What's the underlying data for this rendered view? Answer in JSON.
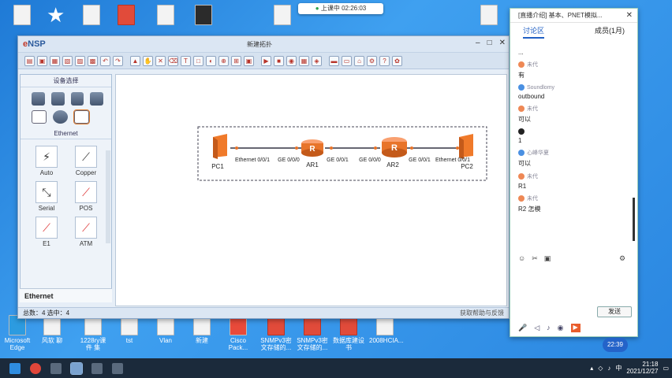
{
  "desktop": {
    "bottom_icons": [
      {
        "label": "Microsoft Edge"
      },
      {
        "label": "风软 聊"
      },
      {
        "label": "1228ry课件 集"
      },
      {
        "label": "tst"
      },
      {
        "label": "Vlan"
      },
      {
        "label": "新建"
      },
      {
        "label": "Cisco Pack..."
      },
      {
        "label": "SNMPv3密 文存储的..."
      },
      {
        "label": "SNMPv3密 文存储的..."
      },
      {
        "label": "数据库建设 书"
      },
      {
        "label": "2008HCIA..."
      }
    ]
  },
  "recording": {
    "status": "上课中",
    "time": "02:26:03"
  },
  "ensp": {
    "logo_e": "e",
    "logo_rest": "NSP",
    "window_title": "新建拓扑",
    "device_panel_title": "设备选择",
    "category_label": "Ethernet",
    "cables": [
      {
        "label": "Auto",
        "glyph": "⚡"
      },
      {
        "label": "Copper",
        "glyph": "⟋"
      },
      {
        "label": "Serial",
        "glyph": "⤡"
      },
      {
        "label": "POS",
        "glyph": "⟋"
      },
      {
        "label": "E1",
        "glyph": "⟋"
      },
      {
        "label": "ATM",
        "glyph": "⟋"
      }
    ],
    "selected_category": "Ethernet",
    "status_left": "总数：4 选中：4",
    "status_right": "获取帮助与反馈",
    "topology": {
      "pc1": "PC1",
      "pc2": "PC2",
      "ar1": "AR1",
      "ar2": "AR2",
      "port_pc1": "Ethernet 0/0/1",
      "port_ar1_left": "GE 0/0/0",
      "port_ar1_right": "GE 0/0/1",
      "port_ar2_left": "GE 0/0/0",
      "port_ar2_right": "GE 0/0/1",
      "port_pc2": "Ethernet 0/0/1",
      "accent": "#e8742a"
    }
  },
  "chat": {
    "title": "[直播介绍] 基本、PNET模拟...",
    "tab_discussion": "讨论区",
    "tab_members": "成员(1月)",
    "messages": [
      {
        "user": "",
        "text": "...",
        "avatar": "dark"
      },
      {
        "user": "未代",
        "text": "有",
        "avatar": "orange"
      },
      {
        "user": "Soundlomy",
        "text": "outbound",
        "avatar": "blue"
      },
      {
        "user": "未代",
        "text": "可以",
        "avatar": "orange"
      },
      {
        "user": "",
        "text": "1",
        "avatar": "dark"
      },
      {
        "user": "心峰华夏",
        "text": "可以",
        "avatar": "blue"
      },
      {
        "user": "未代",
        "text": "R1",
        "avatar": "orange"
      },
      {
        "user": "未代",
        "text": "R2 怎模",
        "avatar": "orange"
      }
    ],
    "send_label": "发送",
    "timer": "22:39"
  },
  "taskbar": {
    "time": "21:18",
    "date": "2021/12/27",
    "lang": "中"
  }
}
